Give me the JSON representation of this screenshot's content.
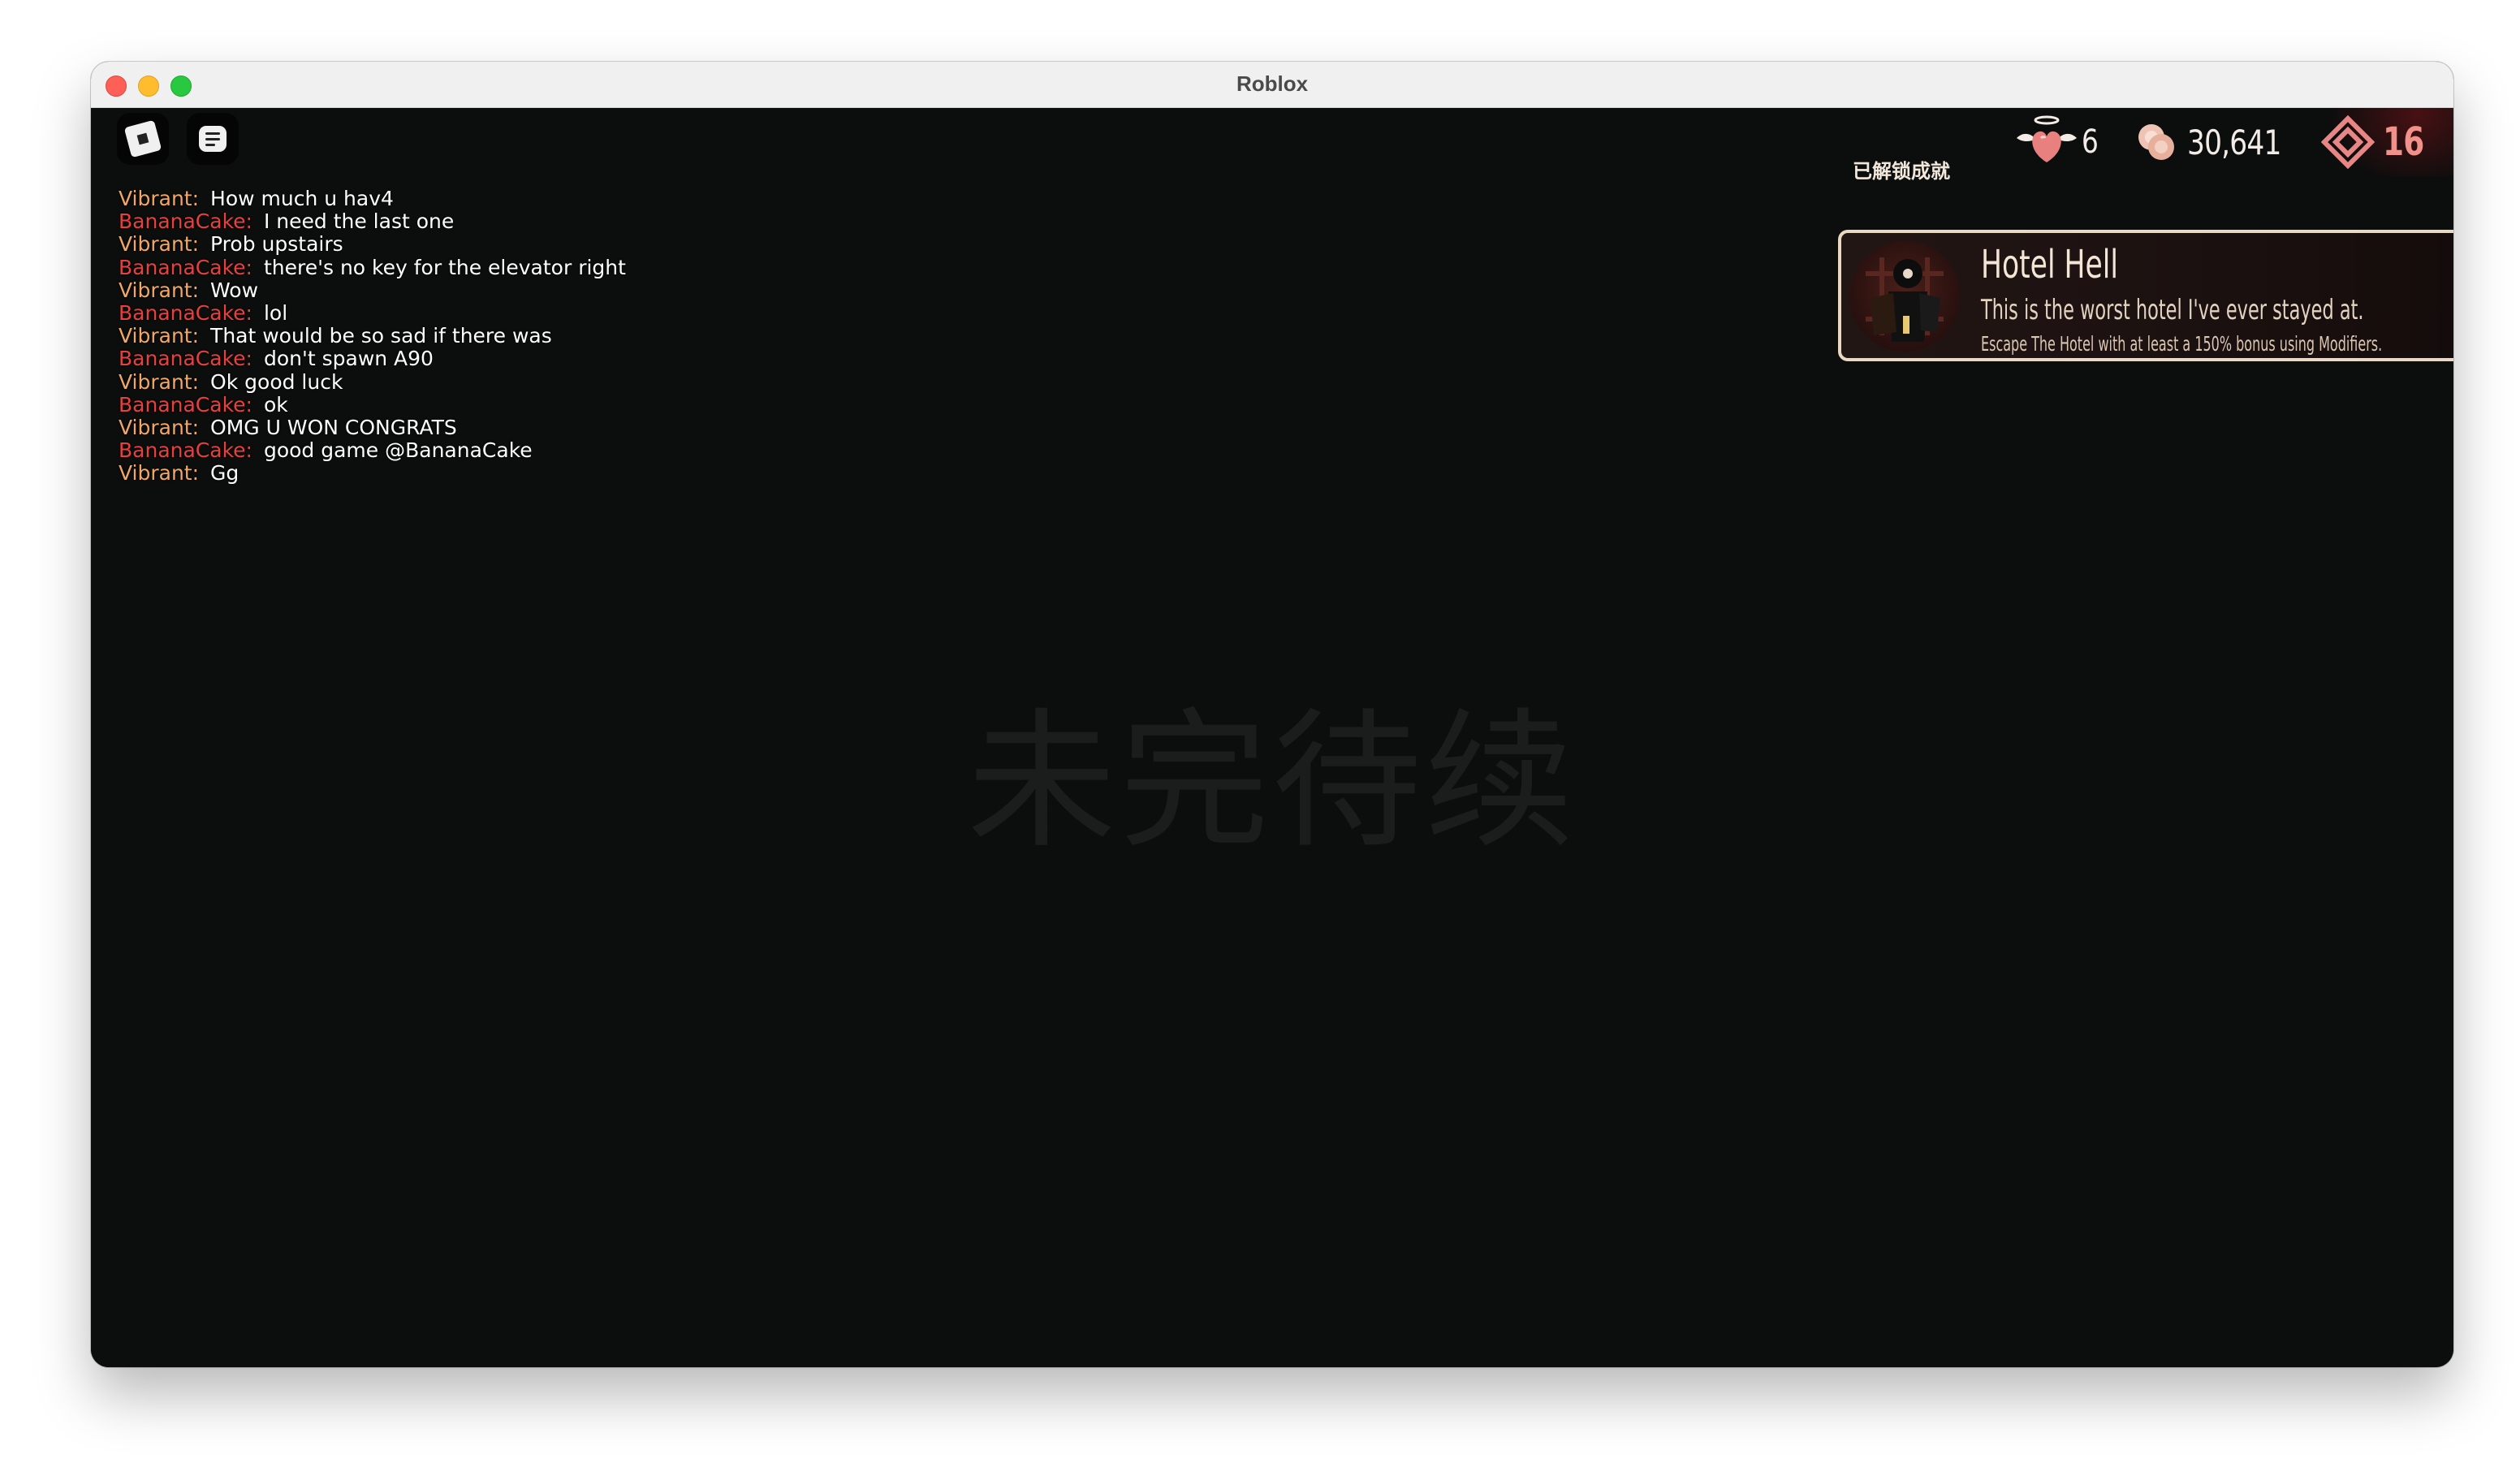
{
  "window": {
    "title": "Roblox"
  },
  "toolbar": {
    "roblox_icon": "roblox-logo-icon",
    "chat_icon": "chat-icon"
  },
  "colors": {
    "name_vibrant": "#f2a765",
    "name_bananacake": "#e5413f",
    "revives": "#f2908a"
  },
  "chat": {
    "messages": [
      {
        "name": "Vibrant:",
        "text": "How much u hav4",
        "color": "#f2a765"
      },
      {
        "name": "BananaCake:",
        "text": "I need the last one",
        "color": "#e5413f"
      },
      {
        "name": "Vibrant:",
        "text": "Prob upstairs",
        "color": "#f2a765"
      },
      {
        "name": "BananaCake:",
        "text": "there's no key for the elevator right",
        "color": "#e5413f"
      },
      {
        "name": "Vibrant:",
        "text": "Wow",
        "color": "#f2a765"
      },
      {
        "name": "BananaCake:",
        "text": "lol",
        "color": "#e5413f"
      },
      {
        "name": "Vibrant:",
        "text": "That would be so sad if there was",
        "color": "#f2a765"
      },
      {
        "name": "BananaCake:",
        "text": "don't spawn A90",
        "color": "#e5413f"
      },
      {
        "name": "Vibrant:",
        "text": "Ok good luck",
        "color": "#f2a765"
      },
      {
        "name": "BananaCake:",
        "text": "ok",
        "color": "#e5413f"
      },
      {
        "name": "Vibrant:",
        "text": "OMG U WON CONGRATS",
        "color": "#f2a765"
      },
      {
        "name": "BananaCake:",
        "text": "good game @BananaCake",
        "color": "#e5413f"
      },
      {
        "name": "Vibrant:",
        "text": "Gg",
        "color": "#f2a765"
      }
    ]
  },
  "currency": {
    "lives": "6",
    "knobs": "30,641",
    "revives": "16",
    "lives_icon": "winged-heart-icon",
    "knobs_icon": "knobs-icon",
    "revives_icon": "revive-diamond-icon"
  },
  "achievement": {
    "header": "已解锁成就",
    "name": "Hotel Hell",
    "description": "This is the worst hotel I've ever stayed at.",
    "requirement": "Escape The Hotel with at least a 150% bonus using Modifiers.",
    "icon": "achievement-figure-icon"
  },
  "watermark": "未完待续"
}
